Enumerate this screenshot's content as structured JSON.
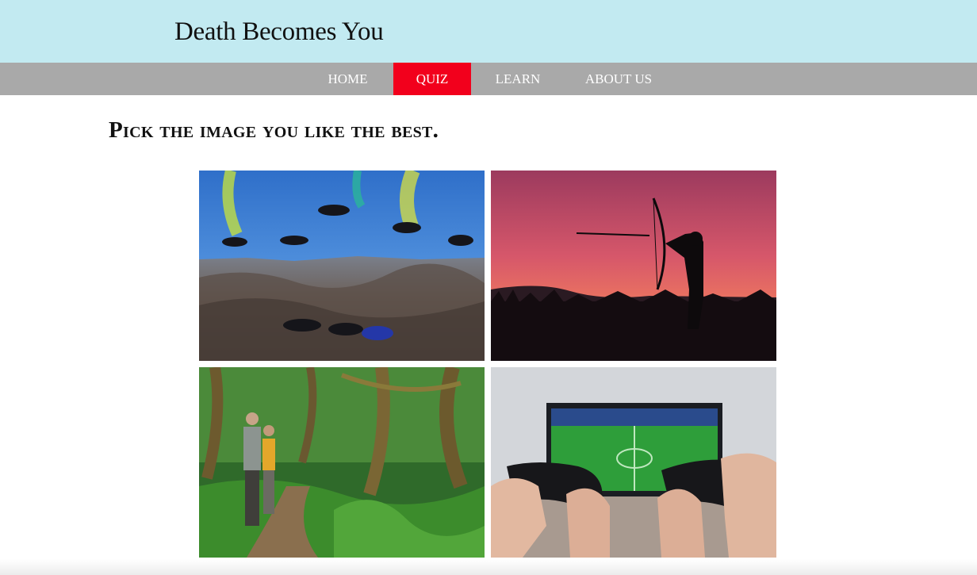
{
  "site": {
    "title": "Death Becomes You"
  },
  "nav": {
    "items": [
      {
        "label": "HOME",
        "active": false
      },
      {
        "label": "QUIZ",
        "active": true
      },
      {
        "label": "LEARN",
        "active": false
      },
      {
        "label": "ABOUT US",
        "active": false
      }
    ]
  },
  "quiz": {
    "prompt": "Pick the image you like the best.",
    "images": [
      {
        "id": "skydiving",
        "icon": "skydivers-photo"
      },
      {
        "id": "archery",
        "icon": "archer-sunset-photo"
      },
      {
        "id": "hiking",
        "icon": "forest-hikers-photo"
      },
      {
        "id": "gaming",
        "icon": "video-game-controllers-photo"
      }
    ]
  },
  "colors": {
    "header_bg": "#c2eaf1",
    "nav_bg": "#a9a9a9",
    "nav_active": "#f2001c"
  }
}
